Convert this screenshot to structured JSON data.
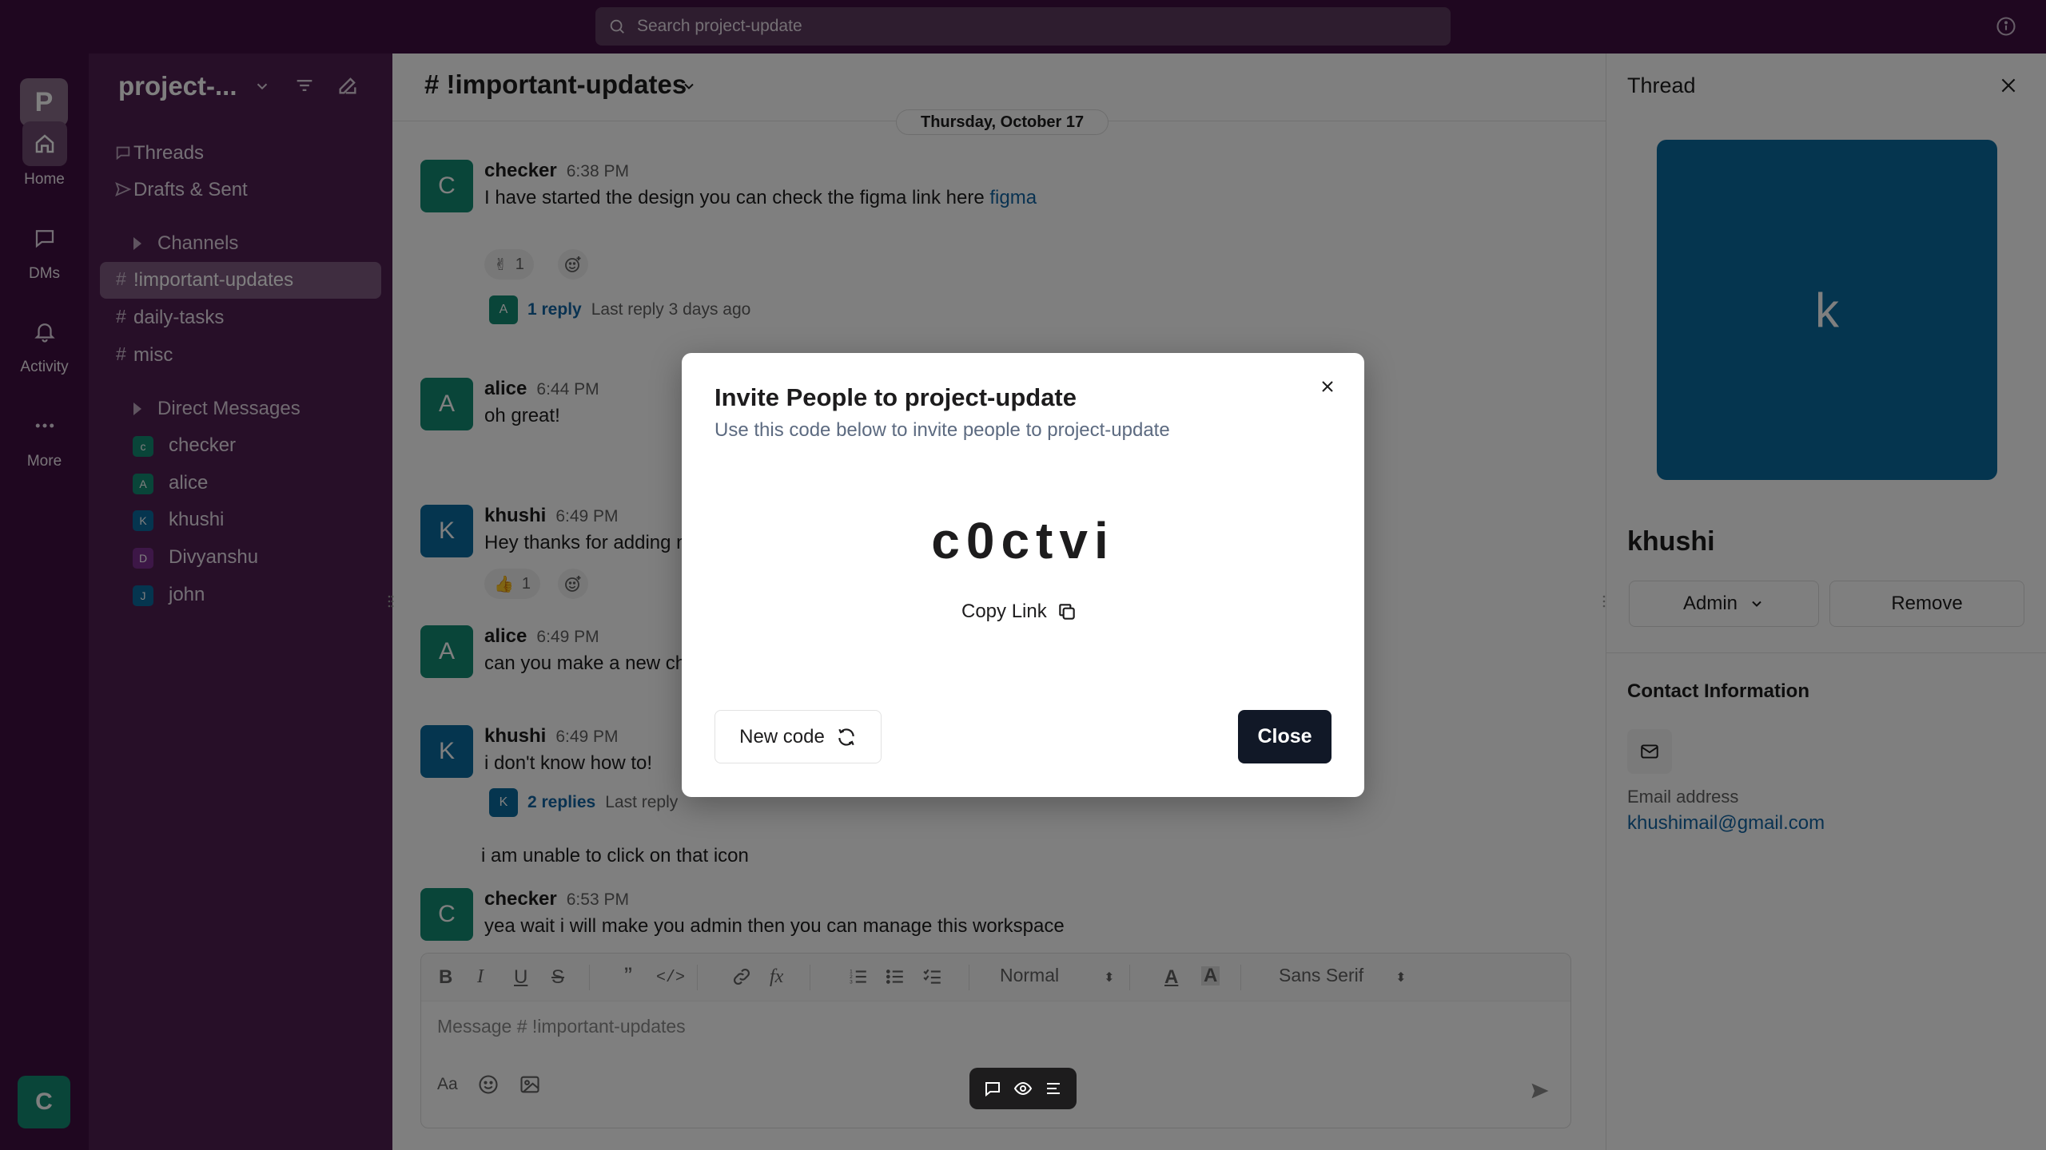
{
  "topbar": {
    "search_placeholder": "Search project-update"
  },
  "rail": {
    "workspace_initial": "P",
    "items": [
      {
        "label": "Home",
        "icon": "home-icon"
      },
      {
        "label": "DMs",
        "icon": "message-icon"
      },
      {
        "label": "Activity",
        "icon": "bell-icon"
      },
      {
        "label": "More",
        "icon": "more-icon"
      }
    ],
    "user_initial": "C"
  },
  "sidebar": {
    "workspace_name": "project-...",
    "threads_label": "Threads",
    "drafts_label": "Drafts & Sent",
    "channels_label": "Channels",
    "channels": [
      "!important-updates",
      "daily-tasks",
      "misc"
    ],
    "dms_label": "Direct Messages",
    "dms": [
      {
        "initial": "c",
        "name": "checker",
        "color": "#138a72"
      },
      {
        "initial": "A",
        "name": "alice",
        "color": "#138a72"
      },
      {
        "initial": "K",
        "name": "khushi",
        "color": "#0b6b9e"
      },
      {
        "initial": "D",
        "name": "Divyanshu",
        "color": "#7b2f8f"
      },
      {
        "initial": "J",
        "name": "john",
        "color": "#0b6b9e"
      }
    ]
  },
  "channel": {
    "title": "# !important-updates",
    "date_divider": "Thursday, October 17",
    "messages": [
      {
        "initial": "C",
        "name": "checker",
        "time": "6:38 PM",
        "text": "I have started the design you can check the figma link here",
        "link": "figma",
        "reaction_count": "1",
        "reply_initial": "A",
        "reply_count": "1 reply",
        "reply_last": "Last reply 3 days ago"
      },
      {
        "initial": "A",
        "name": "alice",
        "time": "6:44 PM",
        "text": "oh great!"
      },
      {
        "initial": "K",
        "name": "khushi",
        "time": "6:49 PM",
        "text": "Hey thanks for adding m",
        "reaction_count": "1"
      },
      {
        "initial": "A",
        "name": "alice",
        "time": "6:49 PM",
        "text": "can you make a new ch"
      },
      {
        "initial": "K",
        "name": "khushi",
        "time": "6:49 PM",
        "text": "i don't know how to!",
        "reply_initial": "K",
        "reply_count": "2 replies",
        "reply_last": "Last reply"
      },
      {
        "continuation": "i am unable to click on that icon"
      },
      {
        "initial": "C",
        "name": "checker",
        "time": "6:53 PM",
        "text": "yea wait i will make you admin then you can manage this workspace"
      }
    ],
    "composer": {
      "placeholder": "Message # !important-updates",
      "heading_select": "Normal",
      "font_select": "Sans Serif",
      "text_style_label": "Aa"
    }
  },
  "thread": {
    "title": "Thread",
    "avatar_initial": "k",
    "user_name": "khushi",
    "role": "Admin",
    "remove_label": "Remove",
    "contact_title": "Contact Information",
    "email_label": "Email address",
    "email": "khushimail@gmail.com"
  },
  "modal": {
    "title": "Invite People to project-update",
    "subtitle": "Use this code below to invite people to project-update",
    "code": "c0ctvi",
    "copy_link": "Copy Link",
    "new_code": "New code",
    "close": "Close"
  }
}
